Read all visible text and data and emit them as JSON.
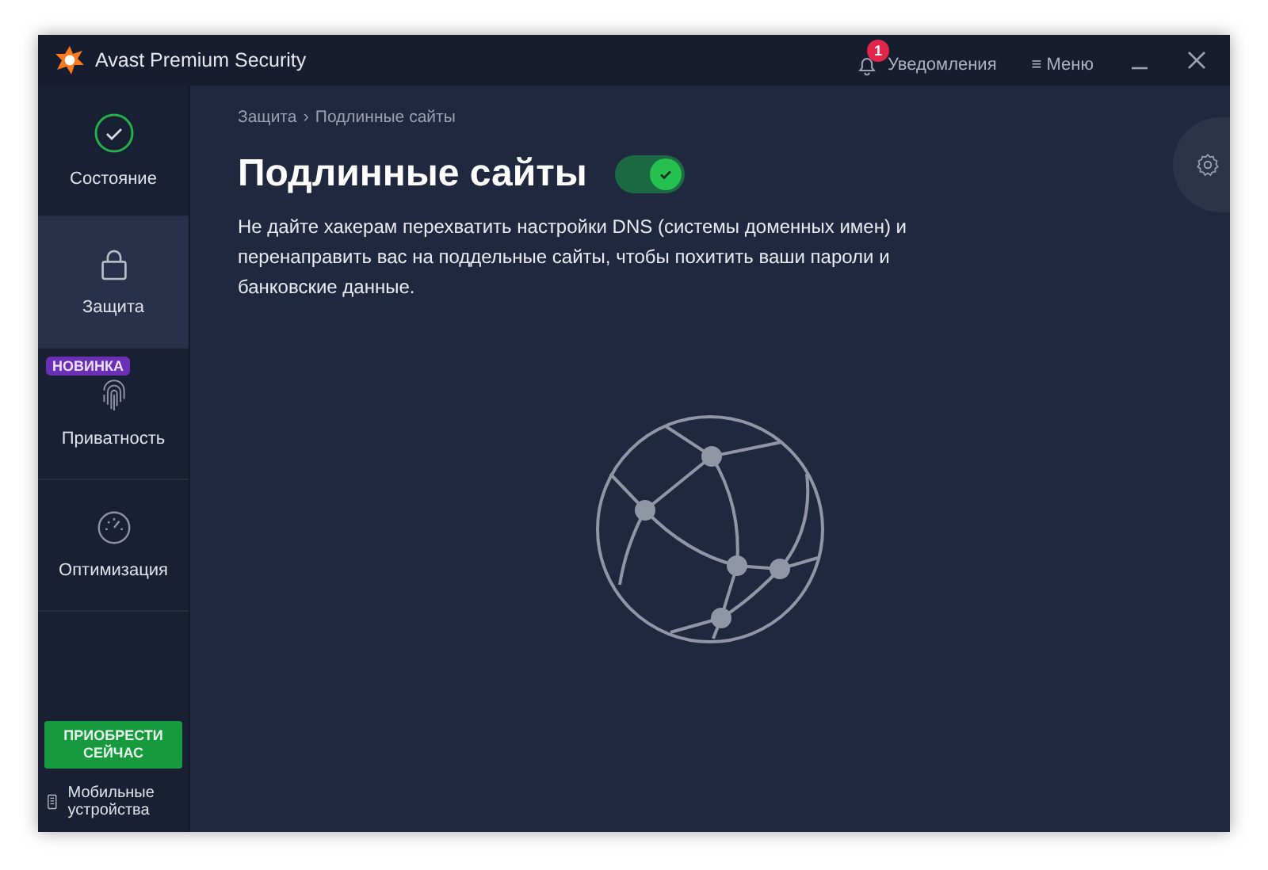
{
  "window": {
    "title": "Avast Premium Security"
  },
  "header": {
    "notifications": {
      "label": "Уведомления",
      "count": "1"
    },
    "menu": {
      "icon": "≡",
      "label": "Меню"
    }
  },
  "sidebar": {
    "items": [
      {
        "kind": "status",
        "label": "Состояние",
        "selected": false
      },
      {
        "kind": "protection",
        "label": "Защита",
        "selected": true
      },
      {
        "kind": "privacy",
        "label": "Приватность",
        "selected": false,
        "badge": "НОВИНКА"
      },
      {
        "kind": "performance",
        "label": "Оптимизация",
        "selected": false
      }
    ],
    "buy_button": "ПРИОБРЕСТИ СЕЙЧАС",
    "mobile": "Мобильные устройства"
  },
  "breadcrumb": [
    "Защита",
    "›",
    "Подлинные сайты"
  ],
  "page": {
    "title": "Подлинные сайты",
    "enabled": true,
    "description": "Не дайте хакерам перехватить настройки DNS (системы доменных имен) и перенаправить вас на поддельные сайты, чтобы похитить ваши пароли и банковские данные."
  }
}
